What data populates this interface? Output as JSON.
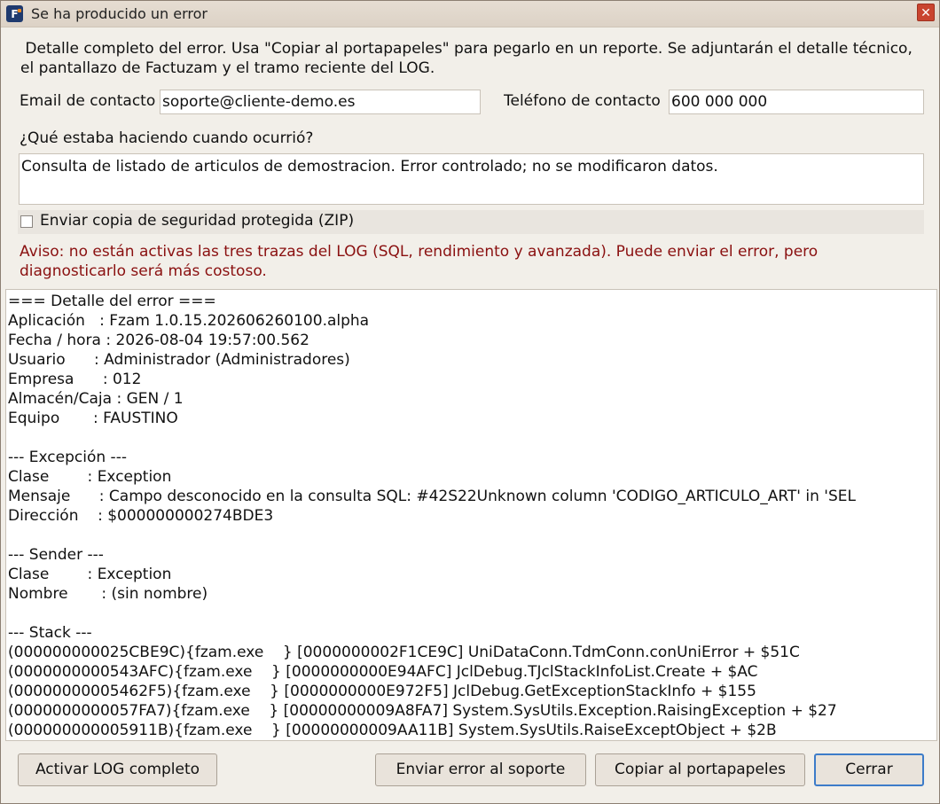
{
  "window": {
    "title": "Se ha producido un error",
    "app_icon_letter": "F",
    "close_label": "✕"
  },
  "intro": "Detalle completo del error. Usa \"Copiar al portapapeles\" para pegarlo en un reporte. Se adjuntarán el detalle técnico, el pantallazo de Factuzam y el tramo reciente del LOG.",
  "contact": {
    "email_label": "Email de contacto",
    "email_value": "soporte@cliente-demo.es",
    "phone_label": "Teléfono de contacto",
    "phone_value": "600 000 000"
  },
  "activity": {
    "label": "¿Qué estaba haciendo cuando ocurrió?",
    "value": "Consulta de listado de articulos de demostracion. Error controlado; no se modificaron datos."
  },
  "backup": {
    "label": "Enviar copia de seguridad protegida (ZIP)",
    "checked": false
  },
  "warning": "Aviso: no están activas las tres trazas del LOG (SQL, rendimiento y avanzada). Puede enviar el error, pero diagnosticarlo será más costoso.",
  "detail_lines": [
    "=== Detalle del error ===",
    "Aplicación   : Fzam 1.0.15.202606260100.alpha",
    "Fecha / hora : 2026-08-04 19:57:00.562",
    "Usuario      : Administrador (Administradores)",
    "Empresa      : 012",
    "Almacén/Caja : GEN / 1",
    "Equipo       : FAUSTINO",
    "",
    "--- Excepción ---",
    "Clase        : Exception",
    "Mensaje      : Campo desconocido en la consulta SQL: #42S22Unknown column 'CODIGO_ARTICULO_ART' in 'SEL",
    "Dirección    : $000000000274BDE3",
    "",
    "--- Sender ---",
    "Clase        : Exception",
    "Nombre       : (sin nombre)",
    "",
    "--- Stack ---",
    "(000000000025CBE9C){fzam.exe    } [0000000002F1CE9C] UniDataConn.TdmConn.conUniError + $51C",
    "(0000000000543AFC){fzam.exe    } [0000000000E94AFC] JclDebug.TJclStackInfoList.Create + $AC",
    "(00000000005462F5){fzam.exe    } [0000000000E972F5] JclDebug.GetExceptionStackInfo + $155",
    "(0000000000057FA7){fzam.exe    } [00000000009A8FA7] System.SysUtils.Exception.RaisingException + $27",
    "(000000000005911B){fzam.exe    } [00000000009AA11B] System.SysUtils.RaiseExceptObject + $2B"
  ],
  "buttons": {
    "activate_log": "Activar LOG completo",
    "send_error": "Enviar error al soporte",
    "copy_clipboard": "Copiar al portapapeles",
    "close": "Cerrar"
  }
}
